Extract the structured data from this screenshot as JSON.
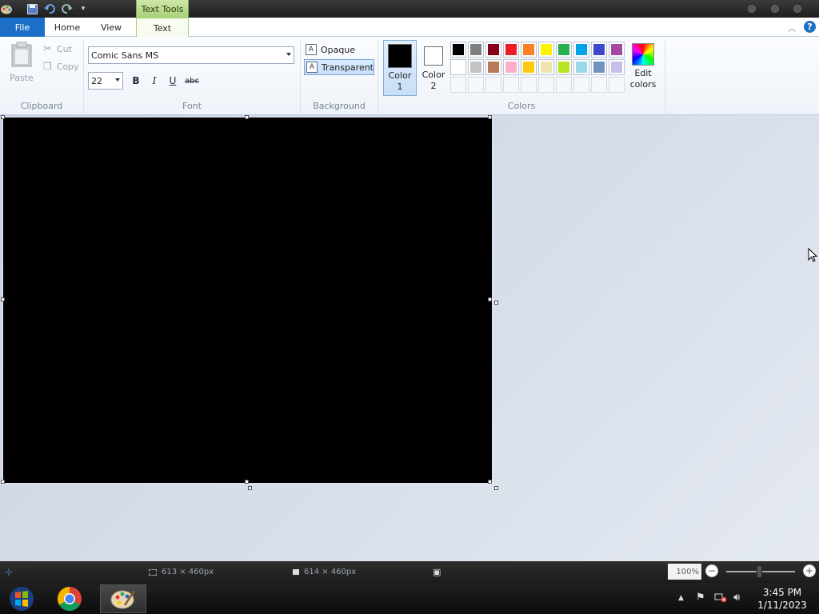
{
  "ribbon_context_tab": "Text Tools",
  "tabs": {
    "file": "File",
    "home": "Home",
    "view": "View",
    "text": "Text"
  },
  "clipboard": {
    "paste": "Paste",
    "cut": "Cut",
    "copy": "Copy",
    "label": "Clipboard"
  },
  "font": {
    "family": "Comic Sans MS",
    "size": "22",
    "bold": "B",
    "italic": "I",
    "underline": "U",
    "strike": "abc",
    "label": "Font"
  },
  "background": {
    "opaque": "Opaque",
    "transparent": "Transparent",
    "label": "Background",
    "selected": "transparent"
  },
  "colors": {
    "color1_line1": "Color",
    "color1_line2": "1",
    "color1_value": "#000000",
    "color2_line1": "Color",
    "color2_line2": "2",
    "color2_value": "#ffffff",
    "label": "Colors",
    "edit_line1": "Edit",
    "edit_line2": "colors",
    "palette_row1": [
      "#000000",
      "#7f7f7f",
      "#880015",
      "#ed1c24",
      "#ff7f27",
      "#fff200",
      "#22b14c",
      "#00a2e8",
      "#3f48cc",
      "#a349a4"
    ],
    "palette_row2": [
      "#ffffff",
      "#c3c3c3",
      "#b97a57",
      "#ffaec9",
      "#ffc90e",
      "#efe4b0",
      "#b5e61d",
      "#99d9ea",
      "#7092be",
      "#c8bfe7"
    ]
  },
  "status": {
    "selection_size": "613 × 460px",
    "canvas_size": "614 × 460px",
    "zoom": "100%"
  },
  "taskbar": {
    "time": "3:45 PM",
    "date": "1/11/2023"
  }
}
